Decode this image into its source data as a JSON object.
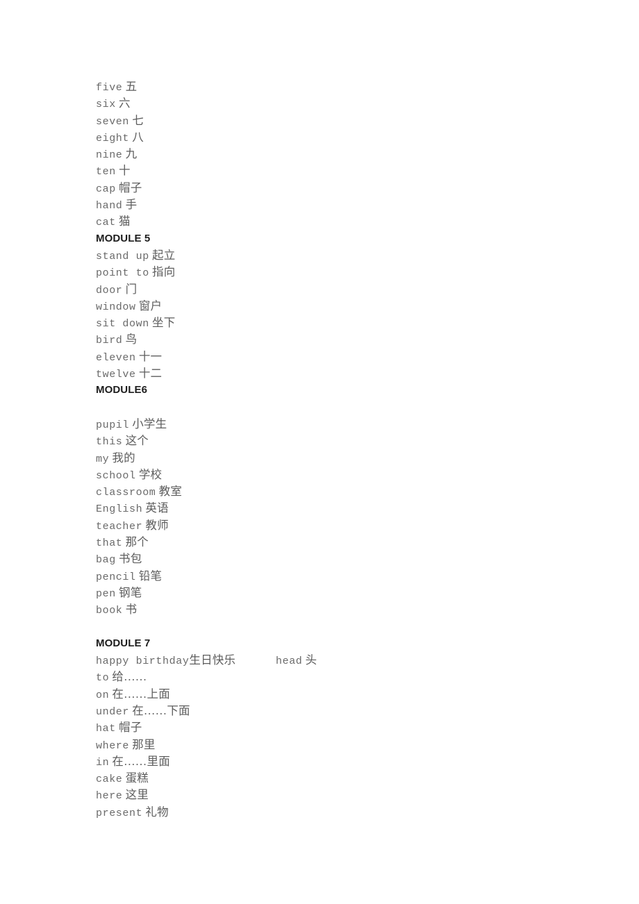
{
  "document": {
    "type": "vocabulary-list",
    "language_pair": "English-Chinese",
    "text_color": "#6a6a6a",
    "heading_color": "#1d1d1d",
    "background": "#ffffff"
  },
  "blocks": [
    {
      "kind": "entry",
      "en": "five",
      "zh": "五"
    },
    {
      "kind": "entry",
      "en": "six",
      "zh": "六"
    },
    {
      "kind": "entry",
      "en": "seven",
      "zh": "七"
    },
    {
      "kind": "entry",
      "en": "eight",
      "zh": "八"
    },
    {
      "kind": "entry",
      "en": "nine",
      "zh": "九"
    },
    {
      "kind": "entry",
      "en": "ten",
      "zh": "十"
    },
    {
      "kind": "entry",
      "en": "cap",
      "zh": "帽子"
    },
    {
      "kind": "entry",
      "en": "hand",
      "zh": "手"
    },
    {
      "kind": "entry",
      "en": "cat",
      "zh": "猫"
    },
    {
      "kind": "heading",
      "text": "MODULE 5"
    },
    {
      "kind": "entry",
      "en": "stand up",
      "zh": "起立"
    },
    {
      "kind": "entry",
      "en": "point to",
      "zh": "指向"
    },
    {
      "kind": "entry",
      "en": "door",
      "zh": "门"
    },
    {
      "kind": "entry",
      "en": "window",
      "zh": "窗户"
    },
    {
      "kind": "entry",
      "en": "sit down",
      "zh": "坐下"
    },
    {
      "kind": "entry",
      "en": "bird",
      "zh": "鸟"
    },
    {
      "kind": "entry",
      "en": "eleven",
      "zh": "十一"
    },
    {
      "kind": "entry",
      "en": "twelve",
      "zh": "十二"
    },
    {
      "kind": "heading",
      "text": "MODULE6"
    },
    {
      "kind": "blank"
    },
    {
      "kind": "entry",
      "en": "pupil",
      "zh": "小学生"
    },
    {
      "kind": "entry",
      "en": "this",
      "zh": "这个"
    },
    {
      "kind": "entry",
      "en": "my",
      "zh": "我的"
    },
    {
      "kind": "entry",
      "en": "school",
      "zh": "学校"
    },
    {
      "kind": "entry",
      "en": "classroom",
      "zh": "教室"
    },
    {
      "kind": "entry",
      "en": "English",
      "zh": "英语"
    },
    {
      "kind": "entry",
      "en": "teacher",
      "zh": "教师"
    },
    {
      "kind": "entry",
      "en": "that",
      "zh": "那个"
    },
    {
      "kind": "entry",
      "en": "bag",
      "zh": "书包"
    },
    {
      "kind": "entry",
      "en": "pencil",
      "zh": "铅笔"
    },
    {
      "kind": "entry",
      "en": "pen",
      "zh": "钢笔"
    },
    {
      "kind": "entry",
      "en": "book",
      "zh": "书"
    },
    {
      "kind": "blank"
    },
    {
      "kind": "heading",
      "text": "MODULE 7"
    },
    {
      "kind": "entry",
      "en": "happy birthday",
      "zh": "生日快乐",
      "no_gap": true,
      "aside_en": "head",
      "aside_zh": "头"
    },
    {
      "kind": "entry",
      "en": "to",
      "zh": "给……"
    },
    {
      "kind": "entry",
      "en": "on",
      "zh": "在……上面"
    },
    {
      "kind": "entry",
      "en": "under",
      "zh": "在……下面"
    },
    {
      "kind": "entry",
      "en": "hat",
      "zh": "帽子"
    },
    {
      "kind": "entry",
      "en": "where",
      "zh": "那里"
    },
    {
      "kind": "entry",
      "en": "in",
      "zh": "在……里面"
    },
    {
      "kind": "entry",
      "en": "cake",
      "zh": "蛋糕"
    },
    {
      "kind": "entry",
      "en": "here",
      "zh": "这里"
    },
    {
      "kind": "entry",
      "en": "present",
      "zh": "礼物"
    }
  ]
}
